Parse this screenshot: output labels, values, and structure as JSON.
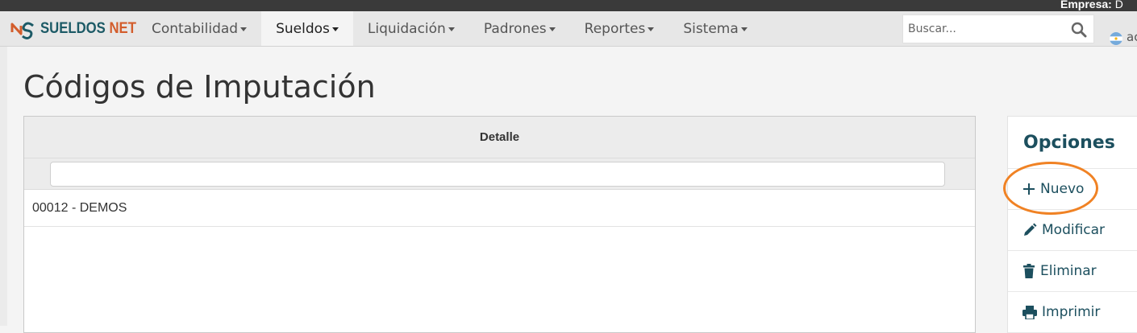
{
  "topbar": {
    "company_label": "Empresa:",
    "company_value": "D"
  },
  "brand": {
    "part1": "SUELDOS",
    "part2": "NET"
  },
  "nav": [
    {
      "label": "Contabilidad",
      "active": false
    },
    {
      "label": "Sueldos",
      "active": true
    },
    {
      "label": "Liquidación",
      "active": false
    },
    {
      "label": "Padrones",
      "active": false
    },
    {
      "label": "Reportes",
      "active": false
    },
    {
      "label": "Sistema",
      "active": false
    }
  ],
  "search": {
    "placeholder": "Buscar..."
  },
  "user": {
    "name": "ac"
  },
  "page": {
    "title": "Códigos de Imputación"
  },
  "table": {
    "column_header": "Detalle",
    "filter_value": "",
    "rows": [
      {
        "detalle": "00012 - DEMOS"
      }
    ]
  },
  "options": {
    "title": "Opciones",
    "items": [
      {
        "label": "Nuevo",
        "icon": "plus-icon"
      },
      {
        "label": "Modificar",
        "icon": "pencil-icon"
      },
      {
        "label": "Eliminar",
        "icon": "trash-icon"
      },
      {
        "label": "Imprimir",
        "icon": "print-icon"
      }
    ]
  },
  "colors": {
    "brand_teal": "#1c5a66",
    "brand_orange": "#d35d2c",
    "annotation_orange": "#f08224",
    "link": "#1c4f5e"
  }
}
